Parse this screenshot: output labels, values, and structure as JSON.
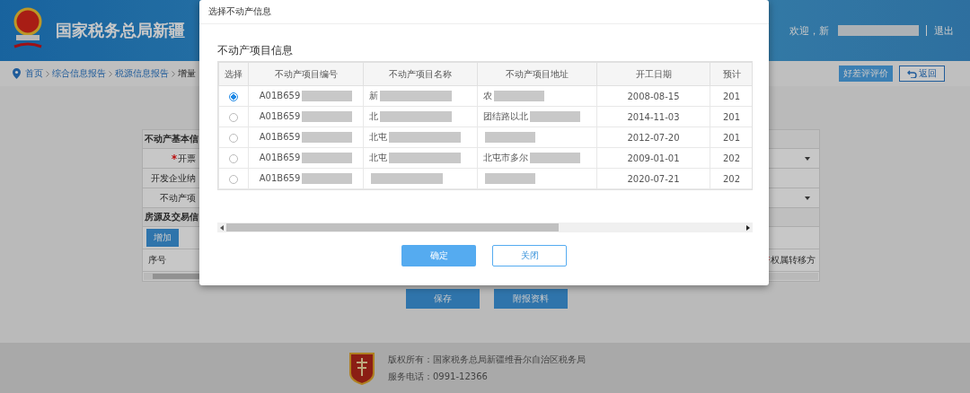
{
  "header": {
    "title": "国家税务总局新疆",
    "welcome": "欢迎，新",
    "logout": "退出"
  },
  "breadcrumb": [
    {
      "label": "首页"
    },
    {
      "label": "综合信息报告"
    },
    {
      "label": "税源信息报告"
    },
    {
      "label": "增量"
    }
  ],
  "actions": {
    "rate": "好差评评价",
    "back": "返回"
  },
  "form": {
    "section_title": "不动产基本信",
    "fields": [
      {
        "label": "开票",
        "required": true,
        "kind": "select"
      },
      {
        "label": "开发企业纳",
        "required": false,
        "kind": "text"
      },
      {
        "label": "不动产项",
        "required": false,
        "kind": "select"
      }
    ],
    "section2_title": "房源及交易信",
    "add_button": "增加",
    "table_columns": [
      {
        "label": "序号",
        "required": false
      },
      {
        "label": "权属转移方",
        "required": true
      }
    ]
  },
  "bottom_buttons": [
    "保存",
    "附报资料"
  ],
  "dialog": {
    "title": "选择不动产信息",
    "section_title": "不动产项目信息",
    "columns": [
      "选择",
      "不动产项目编号",
      "不动产项目名称",
      "不动产项目地址",
      "开工日期",
      "预计"
    ],
    "rows": [
      {
        "selected": true,
        "code": "A01B659",
        "name": "新",
        "address": "农",
        "start_date": "2008-08-15",
        "column_6": "201"
      },
      {
        "selected": false,
        "code": "A01B659",
        "name": "北",
        "address": "团结路以北",
        "start_date": "2014-11-03",
        "column_6": "201"
      },
      {
        "selected": false,
        "code": "A01B659",
        "name": "北屯",
        "address": "",
        "start_date": "2012-07-20",
        "column_6": "201"
      },
      {
        "selected": false,
        "code": "A01B659",
        "name": "北屯",
        "address": "北屯市多尔",
        "start_date": "2009-01-01",
        "column_6": "202"
      },
      {
        "selected": false,
        "code": "A01B659",
        "name": "",
        "address": "",
        "start_date": "2020-07-21",
        "column_6": "202"
      }
    ],
    "buttons": [
      {
        "label": "确定",
        "kind": "primary"
      },
      {
        "label": "关闭",
        "kind": "secondary"
      }
    ]
  },
  "footer": {
    "copyright": "版权所有：国家税务总局新疆维吾尔自治区税务局",
    "phone": "服务电话：0991-12366"
  }
}
